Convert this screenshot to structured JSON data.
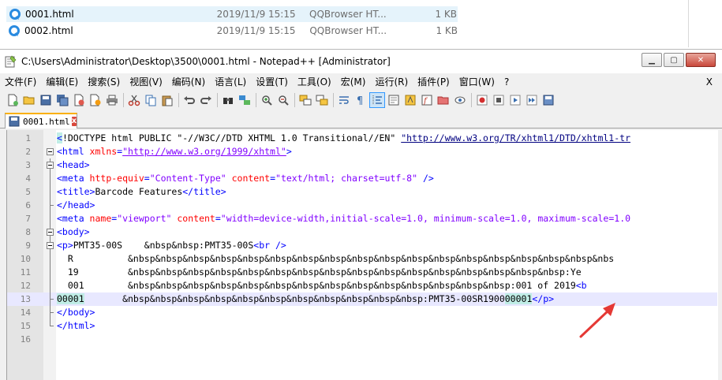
{
  "explorer": {
    "files": [
      {
        "name": "0001.html",
        "date": "2019/11/9 15:15",
        "type": "QQBrowser HT...",
        "size": "1 KB",
        "selected": true
      },
      {
        "name": "0002.html",
        "date": "2019/11/9 15:15",
        "type": "QQBrowser HT...",
        "size": "1 KB",
        "selected": false
      }
    ]
  },
  "window": {
    "title": "C:\\Users\\Administrator\\Desktop\\3500\\0001.html - Notepad++ [Administrator]",
    "minimize": "▁",
    "maximize": "▢",
    "close": "✕"
  },
  "menu": {
    "items": [
      "文件(F)",
      "编辑(E)",
      "搜索(S)",
      "视图(V)",
      "编码(N)",
      "语言(L)",
      "设置(T)",
      "工具(O)",
      "宏(M)",
      "运行(R)",
      "插件(P)",
      "窗口(W)",
      "?"
    ],
    "close": "X"
  },
  "tab": {
    "label": "0001.html",
    "close": "x"
  },
  "editor": {
    "lines": [
      {
        "n": "1"
      },
      {
        "n": "2"
      },
      {
        "n": "3"
      },
      {
        "n": "4"
      },
      {
        "n": "5"
      },
      {
        "n": "6"
      },
      {
        "n": "7"
      },
      {
        "n": "8"
      },
      {
        "n": "9"
      },
      {
        "n": "10"
      },
      {
        "n": "11"
      },
      {
        "n": "12"
      },
      {
        "n": "13"
      },
      {
        "n": "14"
      },
      {
        "n": "15"
      },
      {
        "n": "16"
      }
    ],
    "code": {
      "l1_lt": "<",
      "l1_doctype": "!DOCTYPE html PUBLIC \"-//W3C//DTD XHTML 1.0 Transitional//EN\" ",
      "l1_url": "\"http://www.w3.org/TR/xhtml1/DTD/xhtml1-tr",
      "l2_open": "<html ",
      "l2_attr": "xmlns",
      "l2_eq": "=",
      "l2_val": "\"http://www.w3.org/1999/xhtml\"",
      "l2_close": ">",
      "l3": "<head>",
      "l4_open": "<meta ",
      "l4_attr1": "http-equiv",
      "l4_eq1": "=",
      "l4_val1": "\"Content-Type\"",
      "l4_sp": " ",
      "l4_attr2": "content",
      "l4_eq2": "=",
      "l4_val2": "\"text/html; charset=utf-8\"",
      "l4_close": " />",
      "l5_open": "<title>",
      "l5_text": "Barcode Features",
      "l5_close": "</title>",
      "l6": "</head>",
      "l7_open": "<meta ",
      "l7_attr1": "name",
      "l7_eq1": "=",
      "l7_val1": "\"viewport\"",
      "l7_sp": " ",
      "l7_attr2": "content",
      "l7_eq2": "=",
      "l7_val2": "\"width=device-width,initial-scale=1.0, minimum-scale=1.0, maximum-scale=1.0",
      "l8": "<body>",
      "l9_open": "<p>",
      "l9_text": "PMT35-00S    &nbsp&nbsp:PMT35-00S",
      "l9_br": "<br />",
      "l10": "  R          &nbsp&nbsp&nbsp&nbsp&nbsp&nbsp&nbsp&nbsp&nbsp&nbsp&nbsp&nbsp&nbsp&nbsp&nbsp&nbsp&nbsp&nbs",
      "l11": "  19         &nbsp&nbsp&nbsp&nbsp&nbsp&nbsp&nbsp&nbsp&nbsp&nbsp&nbsp&nbsp&nbsp&nbsp&nbsp&nbsp:Ye",
      "l12_text": "  001        &nbsp&nbsp&nbsp&nbsp&nbsp&nbsp&nbsp&nbsp&nbsp&nbsp&nbsp&nbsp&nbsp&nbsp:001 of 2019",
      "l12_tag": "<b",
      "l13_sel1": "00001",
      "l13_mid": "       &nbsp&nbsp&nbsp&nbsp&nbsp&nbsp&nbsp&nbsp&nbsp&nbsp&nbsp:PMT35-00SR1900",
      "l13_sel2": "00001",
      "l13_close": "</p>",
      "l14": "</body>",
      "l15": "</html>"
    }
  },
  "colors": {
    "tag": "#0000ff",
    "attribute": "#ff0000",
    "string": "#8000ff",
    "current_line": "#e8e8ff",
    "selection_highlight": "#c0ede6",
    "annotation_arrow": "#e53935"
  }
}
